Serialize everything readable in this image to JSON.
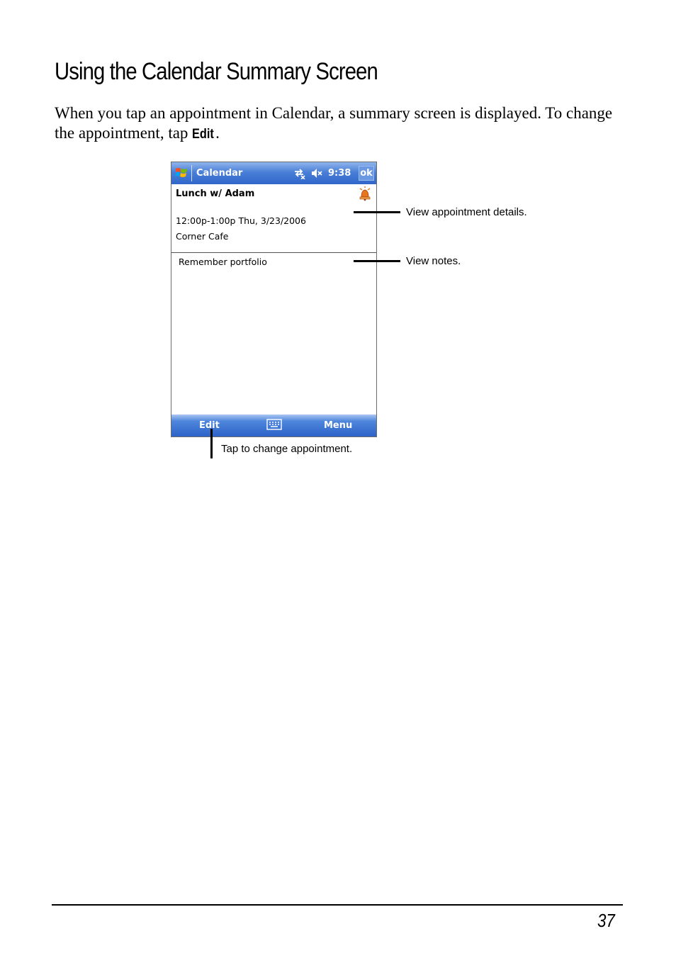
{
  "heading": "Using the Calendar Summary Screen",
  "intro": {
    "text_before": "When you tap an appointment in Calendar, a summary screen is displayed. To change the appointment, tap ",
    "command": "Edit",
    "text_after": "."
  },
  "device": {
    "titlebar": {
      "start_icon": "windows-flag-icon",
      "app_title": "Calendar",
      "connectivity_icon": "connectivity-icon",
      "volume_icon": "volume-muted-icon",
      "time": "9:38",
      "ok_label": "ok"
    },
    "appointment": {
      "subject": "Lunch w/ Adam",
      "reminder_icon": "reminder-bell-icon",
      "time": "12:00p-1:00p Thu, 3/23/2006",
      "location": "Corner Cafe"
    },
    "notes": "Remember portfolio",
    "menubar": {
      "edit_label": "Edit",
      "keyboard_icon": "keyboard-icon",
      "menu_label": "Menu"
    }
  },
  "callouts": {
    "details": "View appointment details.",
    "notes": "View notes.",
    "edit": "Tap to change appointment."
  },
  "page_number": "37"
}
